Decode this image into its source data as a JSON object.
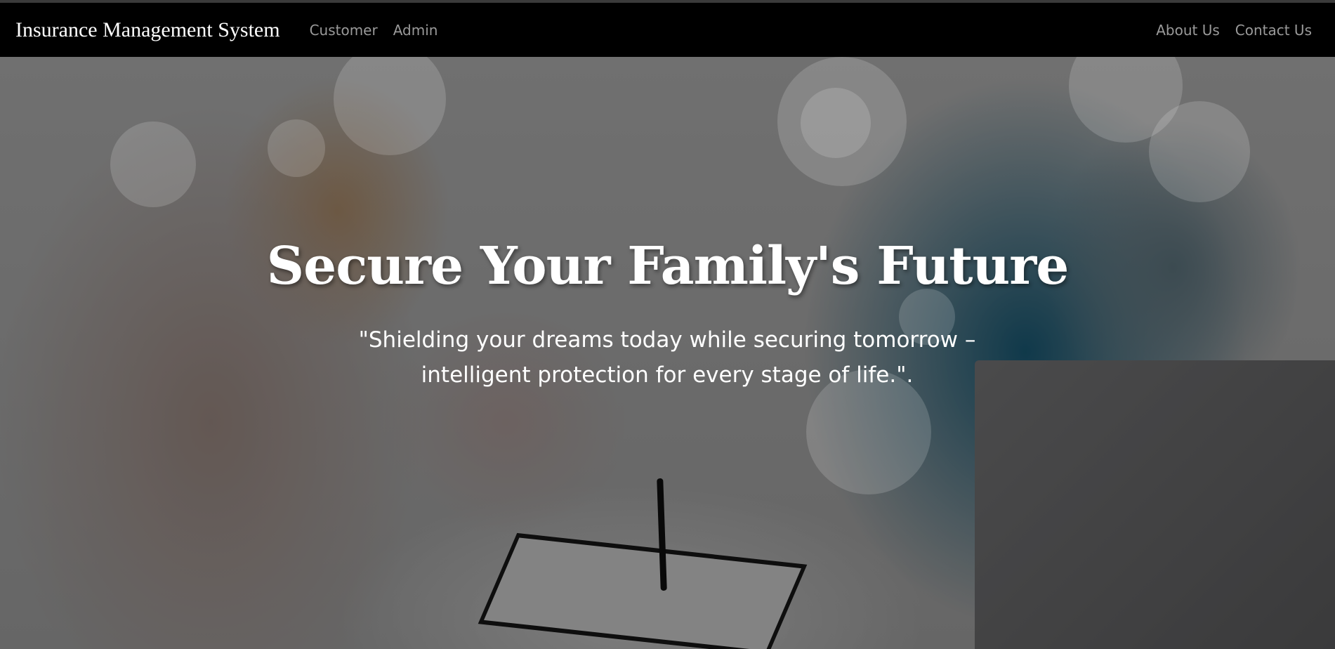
{
  "navbar": {
    "brand": "Insurance Management System",
    "left_links": [
      "Customer",
      "Admin"
    ],
    "right_links": [
      "About Us",
      "Contact Us"
    ]
  },
  "hero": {
    "title": "Secure Your Family's Future",
    "quote": "\"Shielding your dreams today while securing tomorrow – intelligent protection for every stage of life.\"."
  },
  "colors": {
    "navbar_bg": "#000000",
    "nav_link": "#9a9a9a",
    "hero_text": "#ffffff"
  }
}
